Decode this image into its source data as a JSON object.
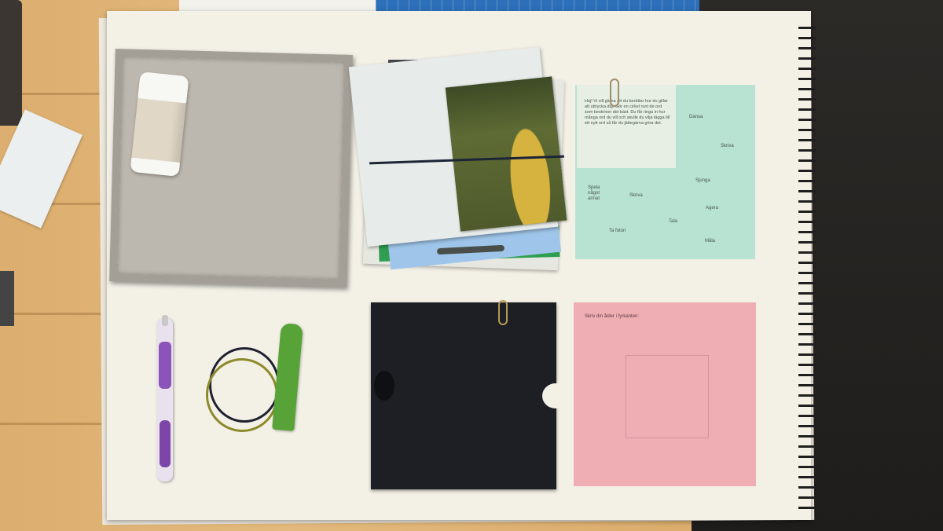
{
  "scene": {
    "green_sheet": {
      "note_text": "Hej! Vi vill gärna att du berättar hur du gillar att uttrycka dig. Gör en cirkel runt de ord som beskriver det bäst. Du får ringa in hur många ord du vill och skulle du vilja lägga till ett nytt ord så får du jättegärna göra det.",
      "words": [
        "Dansa",
        "Skriva",
        "Sjunga",
        "Spela något annat",
        "Skriva",
        "Agera",
        "Tala",
        "Ta foton",
        "Måla"
      ]
    },
    "pink_sheet": {
      "instruction": "Skriv din ålder i fyrkanten:"
    }
  },
  "colors": {
    "pad": "#f3f0e6",
    "green_sheet": "#b8e3d3",
    "pink_sheet": "#efadb4",
    "black_folder": "#1d1f24",
    "crayon": "#58a337",
    "pen_grip": "#8b54b8"
  }
}
